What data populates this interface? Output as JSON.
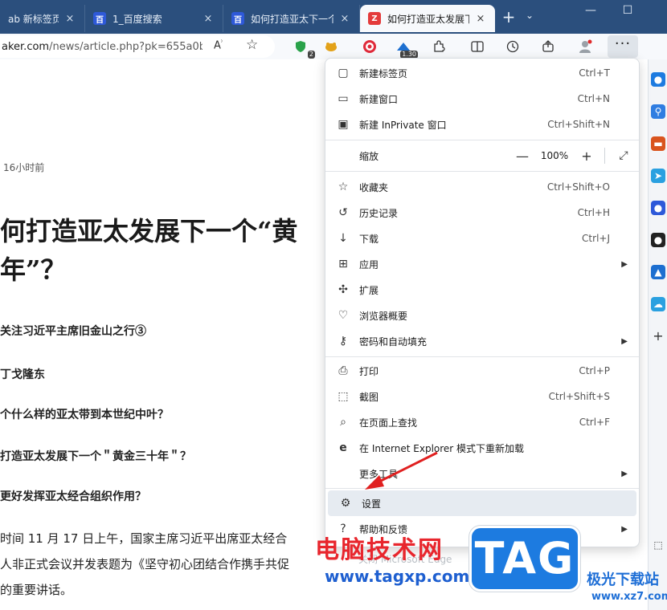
{
  "tabs": [
    {
      "title": "ab 新标签页",
      "favicon": "",
      "active": false
    },
    {
      "title": "1_百度搜索",
      "favicon": "百",
      "active": false
    },
    {
      "title": "如何打造亚太下一个",
      "favicon": "百",
      "active": false
    },
    {
      "title": "如何打造亚太发展下",
      "favicon": "Z",
      "active": true
    }
  ],
  "tab_close": "×",
  "new_tab": "+",
  "tab_list": "⌄",
  "window": {
    "minimize": "—",
    "maximize": "☐"
  },
  "address": {
    "url_prefix": "aker.com",
    "url_rest": "/news/article.php?pk=655a0b..."
  },
  "toolbar_badges": {
    "shield": "2",
    "screen": "1.30"
  },
  "more_button": "···",
  "article": {
    "meta": "16小时前",
    "title_line1": "何打造亚太发展下一个“黄",
    "title_line2": "年”？",
    "subheads": [
      "关注习近平主席旧金山之行③",
      "丁戈隆东",
      "个什么样的亚太带到本世纪中叶？",
      "打造亚太发展下一个＂黄金三十年＂？",
      "更好发挥亚太经合组织作用？"
    ],
    "paras": [
      "时间 11 月 17 日上午，国家主席习近平出席亚太经合",
      "人非正式会议并发表题为《坚守初心团结合作携手共促",
      "的重要讲话。"
    ]
  },
  "menu": {
    "items": [
      {
        "icon": "new-tab-icon",
        "label": "新建标签页",
        "shortcut": "Ctrl+T"
      },
      {
        "icon": "new-window-icon",
        "label": "新建窗口",
        "shortcut": "Ctrl+N"
      },
      {
        "icon": "inprivate-icon",
        "label": "新建 InPrivate 窗口",
        "shortcut": "Ctrl+Shift+N"
      }
    ],
    "zoom": {
      "label": "缩放",
      "minus": "—",
      "value": "100%",
      "plus": "+"
    },
    "items2": [
      {
        "icon": "favorites-icon",
        "label": "收藏夹",
        "shortcut": "Ctrl+Shift+O"
      },
      {
        "icon": "history-icon",
        "label": "历史记录",
        "shortcut": "Ctrl+H"
      },
      {
        "icon": "download-icon",
        "label": "下载",
        "shortcut": "Ctrl+J"
      },
      {
        "icon": "apps-icon",
        "label": "应用",
        "shortcut": "",
        "submenu": true
      },
      {
        "icon": "extensions-icon",
        "label": "扩展",
        "shortcut": ""
      },
      {
        "icon": "browser-essentials-icon",
        "label": "浏览器概要",
        "shortcut": ""
      },
      {
        "icon": "key-icon",
        "label": "密码和自动填充",
        "shortcut": "",
        "submenu": true
      }
    ],
    "items3": [
      {
        "icon": "print-icon",
        "label": "打印",
        "shortcut": "Ctrl+P"
      },
      {
        "icon": "screenshot-icon",
        "label": "截图",
        "shortcut": "Ctrl+Shift+S"
      },
      {
        "icon": "find-icon",
        "label": "在页面上查找",
        "shortcut": "Ctrl+F"
      },
      {
        "icon": "ie-icon",
        "label": "在 Internet Explorer 模式下重新加载",
        "shortcut": ""
      },
      {
        "icon": "",
        "label": "更多工具",
        "shortcut": "",
        "submenu": true
      }
    ],
    "settings": {
      "icon": "gear-icon",
      "label": "设置"
    },
    "help": {
      "icon": "help-icon",
      "label": "帮助和反馈"
    },
    "close": {
      "label": "关闭 Microsoft Edge"
    }
  },
  "watermark": {
    "red_text": "电脑技术网",
    "url": "www.tagxp.com",
    "logo": "TAG",
    "right1": "极光下载站",
    "right2": "www.xz7.com"
  },
  "colors": {
    "tabbar": "#2b4f7d",
    "menu_highlight": "#e6ebf1",
    "arrow": "#e02020",
    "logo": "#1d7be0"
  }
}
